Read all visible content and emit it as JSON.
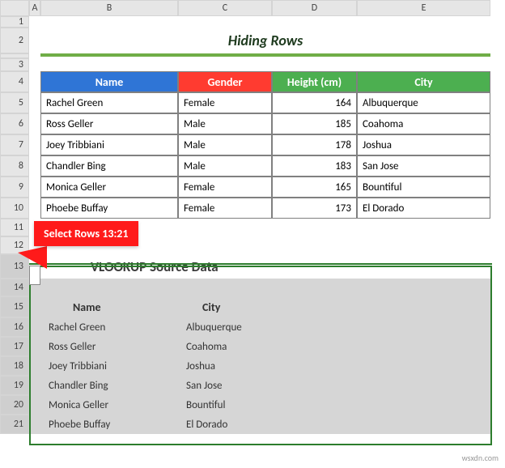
{
  "columns": [
    "",
    "A",
    "B",
    "C",
    "D",
    "E"
  ],
  "rows": [
    "1",
    "2",
    "3",
    "4",
    "5",
    "6",
    "7",
    "8",
    "9",
    "10",
    "11",
    "12",
    "13",
    "14",
    "15",
    "16",
    "17",
    "18",
    "19",
    "20",
    "21"
  ],
  "title": "Hiding Rows",
  "headers": {
    "name": "Name",
    "gender": "Gender",
    "height": "Height (cm)",
    "city": "City"
  },
  "data": [
    {
      "name": "Rachel Green",
      "gender": "Female",
      "height": "164",
      "city": "Albuquerque"
    },
    {
      "name": "Ross Geller",
      "gender": "Male",
      "height": "185",
      "city": "Coahoma"
    },
    {
      "name": "Joey Tribbiani",
      "gender": "Male",
      "height": "178",
      "city": "Joshua"
    },
    {
      "name": "Chandler Bing",
      "gender": "Male",
      "height": "183",
      "city": "San Jose"
    },
    {
      "name": "Monica Geller",
      "gender": "Female",
      "height": "165",
      "city": "Bountiful"
    },
    {
      "name": "Phoebe Buffay",
      "gender": "Female",
      "height": "173",
      "city": "El Dorado"
    }
  ],
  "callout": "Select Rows 13:21",
  "lookup": {
    "title": "VLOOKUP Source Data",
    "headers": {
      "name": "Name",
      "city": "City"
    },
    "rows": [
      {
        "name": "Rachel Green",
        "city": "Albuquerque"
      },
      {
        "name": "Ross Geller",
        "city": "Coahoma"
      },
      {
        "name": "Joey Tribbiani",
        "city": "Joshua"
      },
      {
        "name": "Chandler Bing",
        "city": "San Jose"
      },
      {
        "name": "Monica Geller",
        "city": "Bountiful"
      },
      {
        "name": "Phoebe Buffay",
        "city": "El Dorado"
      }
    ]
  },
  "watermark": "wsxdn.com"
}
